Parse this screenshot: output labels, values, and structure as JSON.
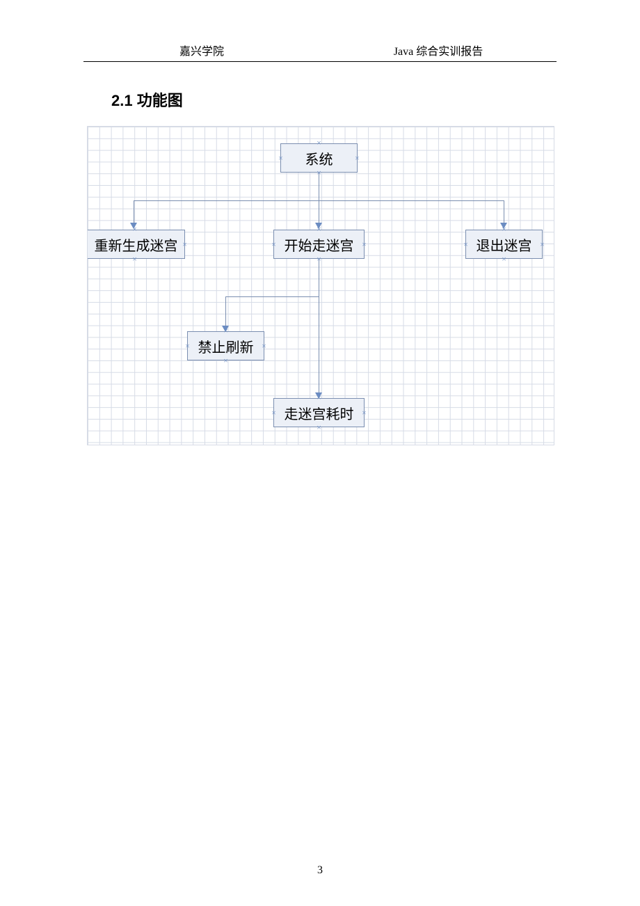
{
  "header": {
    "left": "嘉兴学院",
    "right": "Java 综合实训报告"
  },
  "section_heading": "2.1  功能图",
  "diagram": {
    "nodes": {
      "system": "系统",
      "regen": "重新生成迷宫",
      "start": "开始走迷宫",
      "exit": "退出迷宫",
      "norefresh": "禁止刷新",
      "timing": "走迷宫耗时"
    }
  },
  "page_number": "3"
}
